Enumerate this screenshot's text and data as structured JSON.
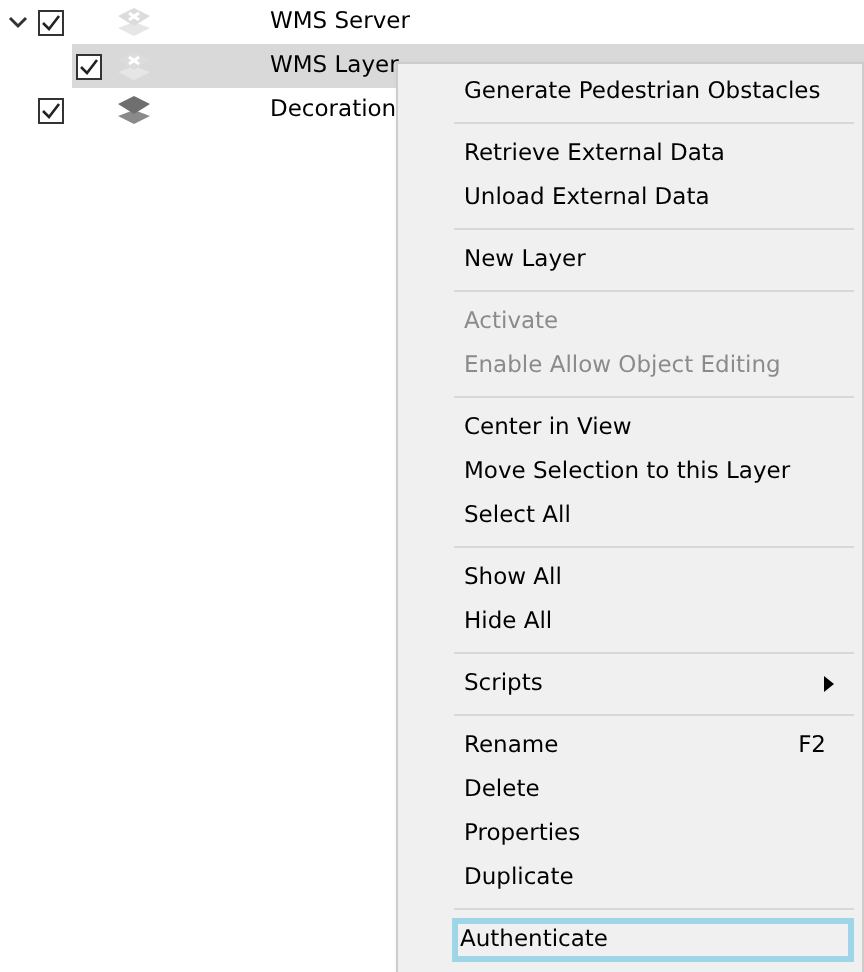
{
  "tree": [
    {
      "label": "WMS Server",
      "kind": "wms",
      "checked": true,
      "expanded": true,
      "selected": false,
      "children": [
        {
          "label": "WMS Layer",
          "kind": "wms",
          "checked": true,
          "selected": true
        }
      ]
    },
    {
      "label": "Decoration",
      "kind": "layer",
      "checked": true,
      "selected": false
    }
  ],
  "context_menu": {
    "groups": [
      [
        {
          "label": "Generate Pedestrian Obstacles",
          "disabled": false,
          "selected": false
        }
      ],
      [
        {
          "label": "Retrieve External Data",
          "disabled": false,
          "selected": false
        },
        {
          "label": "Unload External Data",
          "disabled": false,
          "selected": false
        }
      ],
      [
        {
          "label": "New Layer",
          "disabled": false,
          "selected": false
        }
      ],
      [
        {
          "label": "Activate",
          "disabled": true,
          "selected": false
        },
        {
          "label": "Enable Allow Object Editing",
          "disabled": true,
          "selected": false
        }
      ],
      [
        {
          "label": "Center in View",
          "disabled": false,
          "selected": false
        },
        {
          "label": "Move Selection to this Layer",
          "disabled": false,
          "selected": false
        },
        {
          "label": "Select All",
          "disabled": false,
          "selected": false
        }
      ],
      [
        {
          "label": "Show All",
          "disabled": false,
          "selected": false
        },
        {
          "label": "Hide All",
          "disabled": false,
          "selected": false
        }
      ],
      [
        {
          "label": "Scripts",
          "disabled": false,
          "selected": false,
          "submenu": true
        }
      ],
      [
        {
          "label": "Rename",
          "shortcut": "F2",
          "disabled": false,
          "selected": false
        },
        {
          "label": "Delete",
          "disabled": false,
          "selected": false
        },
        {
          "label": "Properties",
          "disabled": false,
          "selected": false
        },
        {
          "label": "Duplicate",
          "disabled": false,
          "selected": false
        }
      ],
      [
        {
          "label": "Authenticate",
          "disabled": false,
          "selected": true
        }
      ]
    ]
  }
}
